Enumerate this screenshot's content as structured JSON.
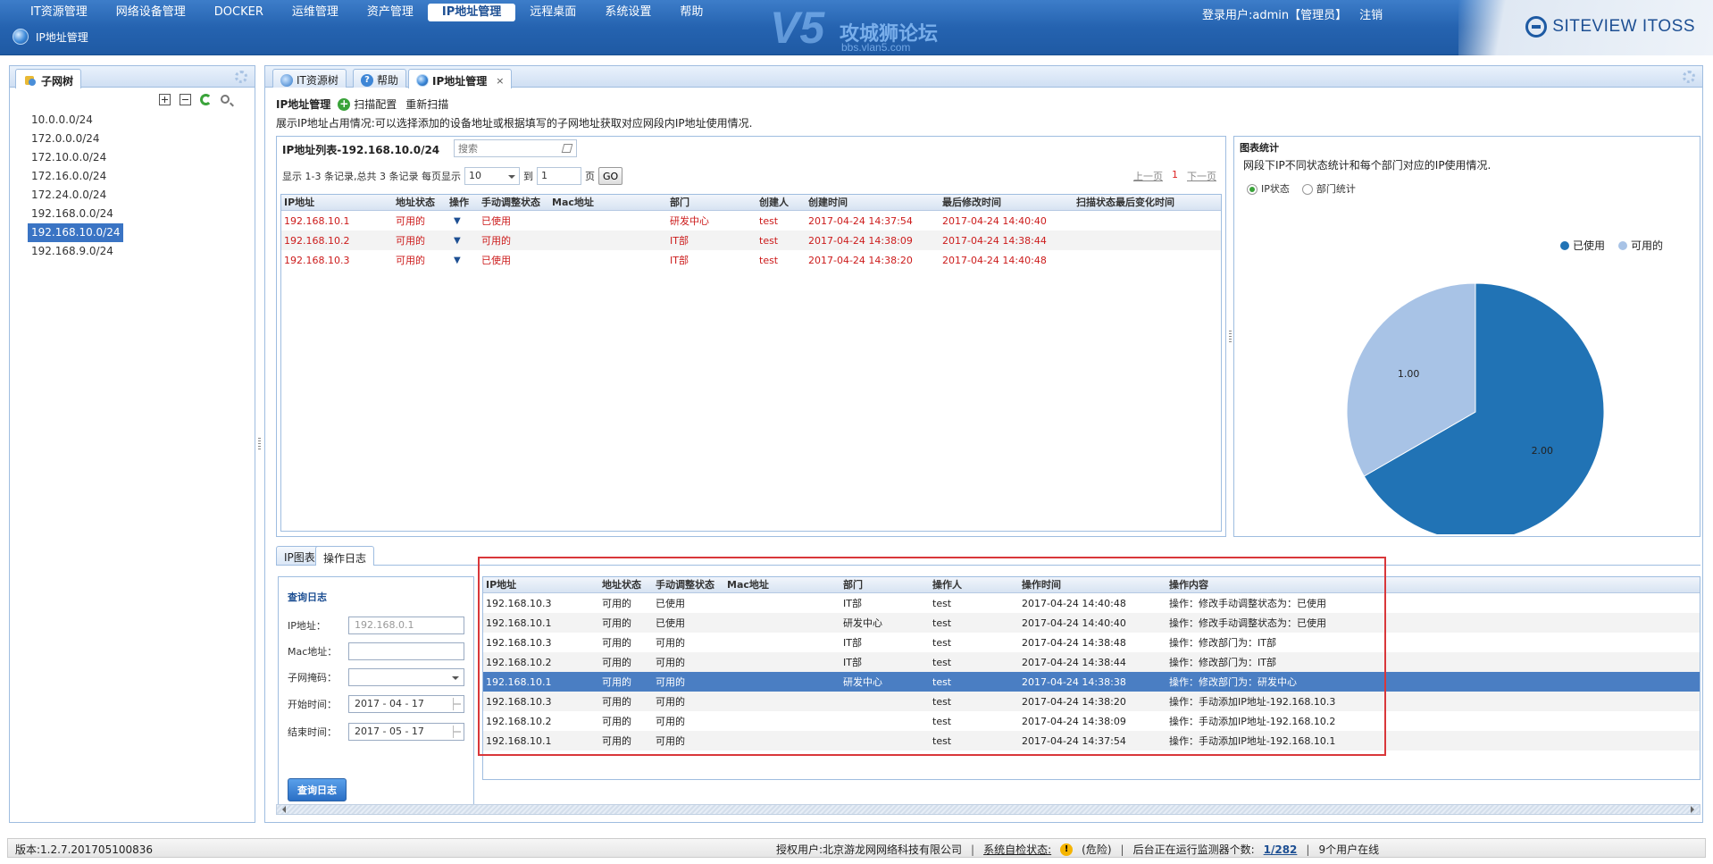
{
  "topnav": {
    "items": [
      "IT资源管理",
      "网络设备管理",
      "DOCKER",
      "运维管理",
      "资产管理",
      "IP地址管理",
      "远程桌面",
      "系统设置",
      "帮助"
    ],
    "active_index": 5,
    "sub_title": "IP地址管理",
    "user": "登录用户:admin【管理员】",
    "logout": "注销",
    "brand": "SITEVIEW ITOSS",
    "watermark": {
      "mark": "V5",
      "text": "攻城狮论坛",
      "url": "bbs.vlan5.com"
    }
  },
  "tree": {
    "tab_label": "子网树",
    "items": [
      "10.0.0.0/24",
      "172.0.0.0/24",
      "172.10.0.0/24",
      "172.16.0.0/24",
      "172.24.0.0/24",
      "192.168.0.0/24",
      "192.168.10.0/24",
      "192.168.9.0/24"
    ],
    "selected_index": 6
  },
  "main_tabs": [
    {
      "label": "IT资源树"
    },
    {
      "label": "帮助"
    },
    {
      "label": "IP地址管理",
      "close": "×"
    }
  ],
  "ip_header": {
    "title": "IP地址管理",
    "scan_config": "扫描配置",
    "rescan": "重新扫描",
    "desc": "展示IP地址占用情况:可以选择添加的设备地址或根据填写的子网地址获取对应网段内IP地址使用情况."
  },
  "ip_list": {
    "title": "IP地址列表-192.168.10.0/24",
    "search_placeholder": "搜索",
    "pager_text": "显示 1-3 条记录,总共 3 条记录 每页显示",
    "page_size": "10",
    "to_label": "到",
    "page_input": "1",
    "page_label": "页",
    "go": "GO",
    "prev": "上一页",
    "current_page": "1",
    "next": "下一页",
    "columns": [
      "IP地址",
      "地址状态",
      "操作",
      "手动调整状态",
      "Mac地址",
      "部门",
      "创建人",
      "创建时间",
      "最后修改时间",
      "扫描状态最后变化时间"
    ],
    "rows": [
      [
        "192.168.10.1",
        "可用的",
        "▼",
        "已使用",
        "",
        "研发中心",
        "test",
        "2017-04-24 14:37:54",
        "2017-04-24 14:40:40",
        ""
      ],
      [
        "192.168.10.2",
        "可用的",
        "▼",
        "可用的",
        "",
        "IT部",
        "test",
        "2017-04-24 14:38:09",
        "2017-04-24 14:38:44",
        ""
      ],
      [
        "192.168.10.3",
        "可用的",
        "▼",
        "已使用",
        "",
        "IT部",
        "test",
        "2017-04-24 14:38:20",
        "2017-04-24 14:40:48",
        ""
      ]
    ]
  },
  "chart_panel": {
    "title": "图表统计",
    "desc": "网段下IP不同状态统计和每个部门对应的IP使用情况.",
    "radio_ip_status": "IP状态",
    "radio_dept": "部门统计",
    "selected": "IP状态"
  },
  "chart_data": {
    "type": "pie",
    "categories": [
      "已使用",
      "可用的"
    ],
    "values": [
      2.0,
      1.0
    ],
    "labels": [
      "2.00",
      "1.00"
    ],
    "colors": [
      "#2173b5",
      "#a8c3e6"
    ],
    "legend_position": "top-right"
  },
  "bottom_tabs": [
    "IP图表",
    "操作日志"
  ],
  "bottom_active_index": 1,
  "query": {
    "title": "查询日志",
    "ip_label": "IP地址：",
    "ip_placeholder": "192.168.0.1",
    "mac_label": "Mac地址：",
    "mac_value": "",
    "mask_label": "子网掩码：",
    "mask_value": "",
    "start_label": "开始时间：",
    "start_value": "2017 - 04 - 17",
    "end_label": "结束时间：",
    "end_value": "2017 - 05 - 17",
    "button": "查询日志"
  },
  "log": {
    "columns": [
      "IP地址",
      "地址状态",
      "手动调整状态",
      "Mac地址",
      "部门",
      "操作人",
      "操作时间",
      "操作内容"
    ],
    "rows": [
      [
        "192.168.10.3",
        "可用的",
        "已使用",
        "",
        "IT部",
        "test",
        "2017-04-24 14:40:48",
        "操作：修改手动调整状态为：已使用"
      ],
      [
        "192.168.10.1",
        "可用的",
        "已使用",
        "",
        "研发中心",
        "test",
        "2017-04-24 14:40:40",
        "操作：修改手动调整状态为：已使用"
      ],
      [
        "192.168.10.3",
        "可用的",
        "可用的",
        "",
        "IT部",
        "test",
        "2017-04-24 14:38:48",
        "操作：修改部门为：IT部"
      ],
      [
        "192.168.10.2",
        "可用的",
        "可用的",
        "",
        "IT部",
        "test",
        "2017-04-24 14:38:44",
        "操作：修改部门为：IT部"
      ],
      [
        "192.168.10.1",
        "可用的",
        "可用的",
        "",
        "研发中心",
        "test",
        "2017-04-24 14:38:38",
        "操作：修改部门为：研发中心"
      ],
      [
        "192.168.10.3",
        "可用的",
        "可用的",
        "",
        "",
        "test",
        "2017-04-24 14:38:20",
        "操作：手动添加IP地址-192.168.10.3"
      ],
      [
        "192.168.10.2",
        "可用的",
        "可用的",
        "",
        "",
        "test",
        "2017-04-24 14:38:09",
        "操作：手动添加IP地址-192.168.10.2"
      ],
      [
        "192.168.10.1",
        "可用的",
        "可用的",
        "",
        "",
        "test",
        "2017-04-24 14:37:54",
        "操作：手动添加IP地址-192.168.10.1"
      ]
    ],
    "highlight_index": 4
  },
  "status": {
    "version": "版本:1.2.7.201705100836",
    "license": "授权用户:北京游龙网网络科技有限公司",
    "self_check_label": "系统自检状态:",
    "self_check_value": "(危险)",
    "monitor_label": "后台正在运行监测器个数:",
    "monitor_count": "1/282",
    "online": "9个用户在线"
  }
}
